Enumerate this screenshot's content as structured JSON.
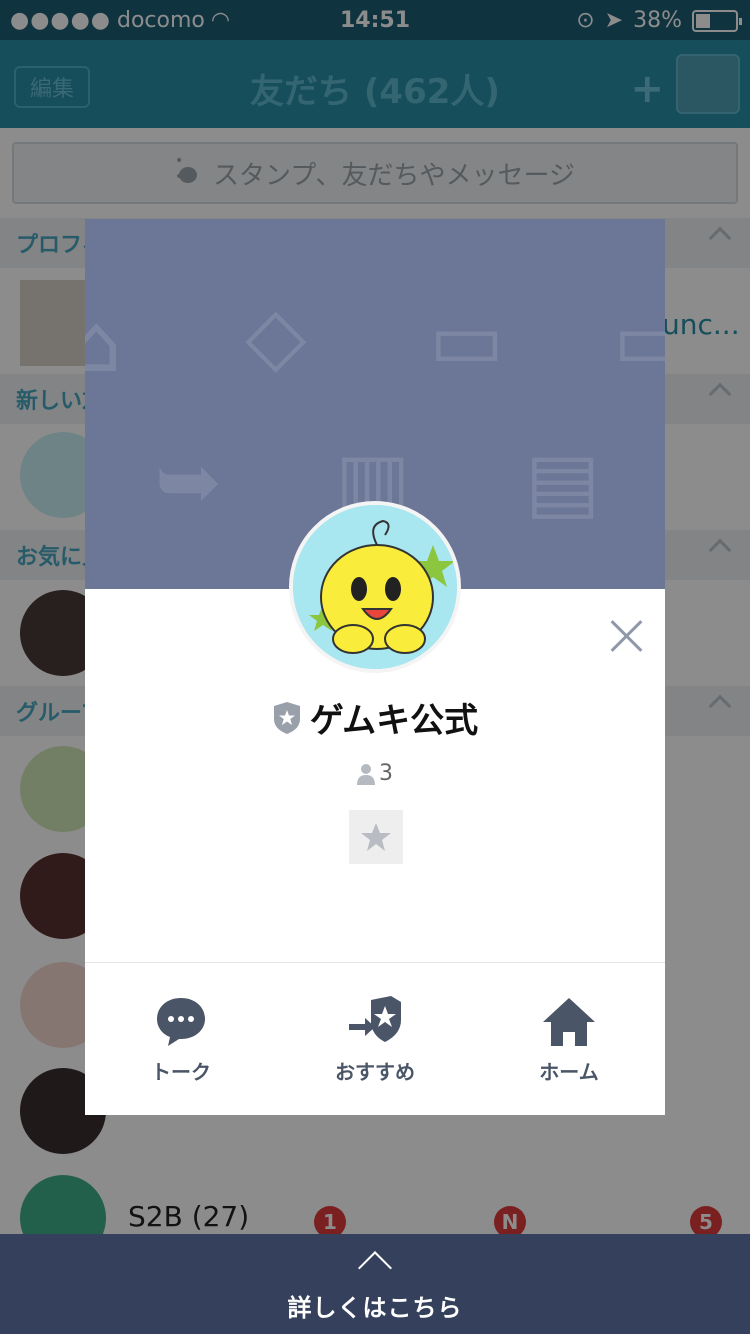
{
  "status_bar": {
    "carrier": "docomo",
    "time": "14:51",
    "battery": "38%"
  },
  "nav": {
    "edit_label": "編集",
    "title": "友だち (462人)"
  },
  "search": {
    "placeholder": "スタンプ、友だちやメッセージ"
  },
  "sections": {
    "profile": "プロフィ",
    "new": "新しい友",
    "favorites": "お気に入",
    "groups": "グループ"
  },
  "background_rows": {
    "row1_suffix": "unc...",
    "row2_name": "S2B (27)"
  },
  "badges": {
    "b1": "1",
    "b2": "N",
    "b3": "5"
  },
  "modal": {
    "name": "ゲムキ公式",
    "member_count": "3",
    "actions": {
      "talk": "トーク",
      "recommend": "おすすめ",
      "home": "ホーム"
    }
  },
  "bottom": {
    "label": "詳しくはこちら"
  },
  "colors": {
    "nav": "#2a8ea6",
    "cover": "#6c7696",
    "bottom_bar": "#34405c",
    "icon": "#4a5568"
  }
}
